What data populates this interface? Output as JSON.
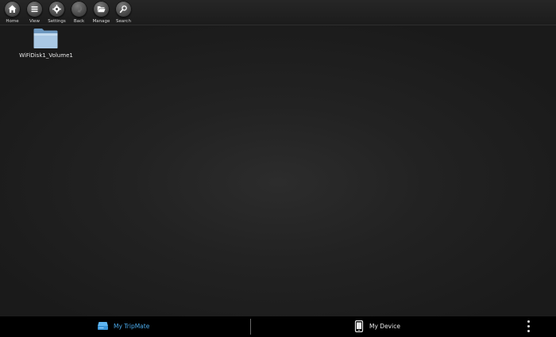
{
  "toolbar": {
    "items": [
      {
        "label": "Home",
        "icon": "home-icon"
      },
      {
        "label": "View",
        "icon": "list-icon"
      },
      {
        "label": "Settings",
        "icon": "gear-icon"
      },
      {
        "label": "Back",
        "icon": "back-arrow-icon"
      },
      {
        "label": "Manage",
        "icon": "folder-open-icon"
      },
      {
        "label": "Search",
        "icon": "magnifier-icon"
      }
    ]
  },
  "files": [
    {
      "name": "WiFiDisk1_Volume1",
      "icon": "folder-icon",
      "color": "#8fb8dd"
    }
  ],
  "bottom_bar": {
    "tabs": [
      {
        "label": "My TripMate",
        "icon": "drive-icon",
        "active": true,
        "color": "#4aa8e8"
      },
      {
        "label": "My Device",
        "icon": "phone-icon",
        "active": false,
        "color": "#e8e8e8"
      }
    ],
    "overflow_icon": "more-vertical-icon"
  }
}
